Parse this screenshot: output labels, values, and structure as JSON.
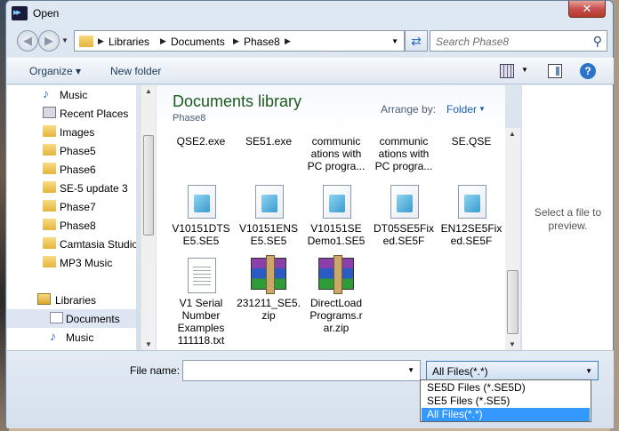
{
  "window": {
    "title": "Open",
    "close_label": "✕"
  },
  "address": {
    "crumbs": [
      "Libraries",
      "Documents",
      "Phase8"
    ]
  },
  "search": {
    "placeholder": "Search Phase8"
  },
  "toolbar": {
    "organize_label": "Organize ▾",
    "new_folder_label": "New folder",
    "help_label": "?"
  },
  "nav": {
    "items": [
      {
        "label": "Music",
        "icon": "music-icon"
      },
      {
        "label": "Recent Places",
        "icon": "recent-places-icon"
      },
      {
        "label": "Images",
        "icon": "folder-icon"
      },
      {
        "label": "Phase5",
        "icon": "folder-icon"
      },
      {
        "label": "Phase6",
        "icon": "folder-icon"
      },
      {
        "label": "SE-5 update 3",
        "icon": "folder-icon"
      },
      {
        "label": "Phase7",
        "icon": "folder-icon"
      },
      {
        "label": "Phase8",
        "icon": "folder-icon"
      },
      {
        "label": "Camtasia Studio",
        "icon": "folder-icon"
      },
      {
        "label": "MP3 Music",
        "icon": "folder-icon"
      },
      {
        "label": "Libraries",
        "icon": "libraries-icon"
      },
      {
        "label": "Documents",
        "icon": "documents-icon"
      },
      {
        "label": "Music",
        "icon": "music-icon"
      }
    ]
  },
  "library": {
    "title": "Documents library",
    "subtitle": "Phase8",
    "arrange_label": "Arrange by:",
    "arrange_value": "Folder"
  },
  "files": [
    {
      "name": "QSE2.exe"
    },
    {
      "name": "SE51.exe"
    },
    {
      "name": "communications with PC progra…",
      "l1": "communic",
      "l2": "ations with",
      "l3": "PC progra..."
    },
    {
      "name": "communications with PC progra…",
      "l1": "communic",
      "l2": "ations with",
      "l3": "PC progra..."
    },
    {
      "name": "SE.QSE"
    },
    {
      "l1": "V10151DTS",
      "l2": "E5.SE5"
    },
    {
      "l1": "V10151ENS",
      "l2": "E5.SE5"
    },
    {
      "l1": "V10151SE",
      "l2": "Demo1.SE5"
    },
    {
      "l1": "DT05SE5Fix",
      "l2": "ed.SE5F"
    },
    {
      "l1": "EN12SE5Fix",
      "l2": "ed.SE5F"
    },
    {
      "l1": "V1 Serial",
      "l2": "Number",
      "l3": "Examples",
      "l4": "111118.txt"
    },
    {
      "l1": "231211_SE5.",
      "l2": "zip"
    },
    {
      "l1": "DirectLoad",
      "l2": "Programs.r",
      "l3": "ar.zip"
    }
  ],
  "preview": {
    "line1": "Select a file to",
    "line2": "preview."
  },
  "bottom": {
    "filename_label": "File name:",
    "filename_value": "",
    "filetype_value": "All Files(*.*)",
    "filetype_options": [
      "SE5D Files (*.SE5D)",
      "SE5 Files (*.SE5)",
      "All Files(*.*)"
    ]
  }
}
